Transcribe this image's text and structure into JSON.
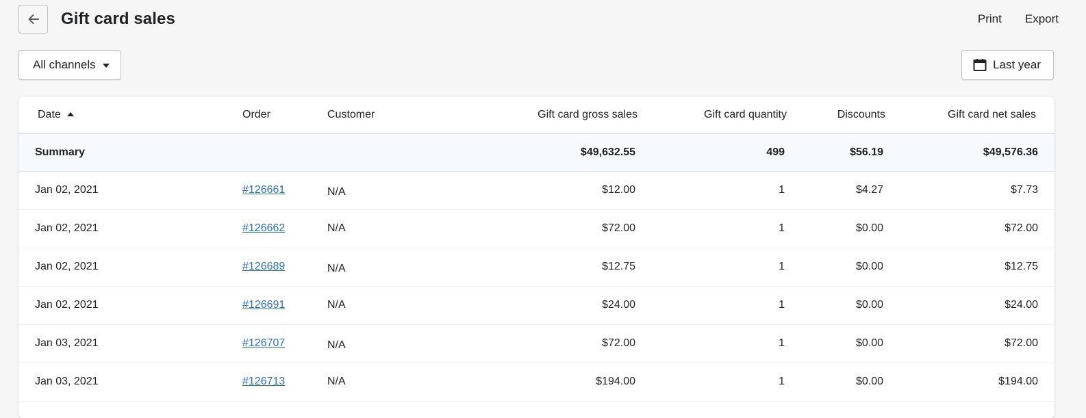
{
  "header": {
    "title": "Gift card sales",
    "actions": [
      "Print",
      "Export"
    ]
  },
  "filters": {
    "channel": "All channels",
    "date_range": "Last year"
  },
  "table": {
    "columns": [
      "Date",
      "Order",
      "Customer",
      "Gift card gross sales",
      "Gift card quantity",
      "Discounts",
      "Gift card net sales"
    ],
    "summary": {
      "label": "Summary",
      "gross": "$49,632.55",
      "quantity": "499",
      "discounts": "$56.19",
      "net": "$49,576.36"
    },
    "rows": [
      {
        "date": "Jan 02, 2021",
        "order": "#126661",
        "customer": "N/A",
        "gross": "$12.00",
        "quantity": "1",
        "discounts": "$4.27",
        "net": "$7.73"
      },
      {
        "date": "Jan 02, 2021",
        "order": "#126662",
        "customer": "N/A",
        "gross": "$72.00",
        "quantity": "1",
        "discounts": "$0.00",
        "net": "$72.00"
      },
      {
        "date": "Jan 02, 2021",
        "order": "#126689",
        "customer": "N/A",
        "gross": "$12.75",
        "quantity": "1",
        "discounts": "$0.00",
        "net": "$12.75"
      },
      {
        "date": "Jan 02, 2021",
        "order": "#126691",
        "customer": "N/A",
        "gross": "$24.00",
        "quantity": "1",
        "discounts": "$0.00",
        "net": "$24.00"
      },
      {
        "date": "Jan 03, 2021",
        "order": "#126707",
        "customer": "N/A",
        "gross": "$72.00",
        "quantity": "1",
        "discounts": "$0.00",
        "net": "$72.00"
      },
      {
        "date": "Jan 03, 2021",
        "order": "#126713",
        "customer": "N/A",
        "gross": "$194.00",
        "quantity": "1",
        "discounts": "$0.00",
        "net": "$194.00"
      }
    ]
  },
  "icons": {
    "back": "arrow-left-icon",
    "channel_caret": "caret-down-icon",
    "calendar": "calendar-icon",
    "sort": "sort-ascending-icon"
  },
  "colors": {
    "link": "#2c6ecb",
    "background": "#f6f6f7",
    "summary_bg": "#f7fafd"
  }
}
